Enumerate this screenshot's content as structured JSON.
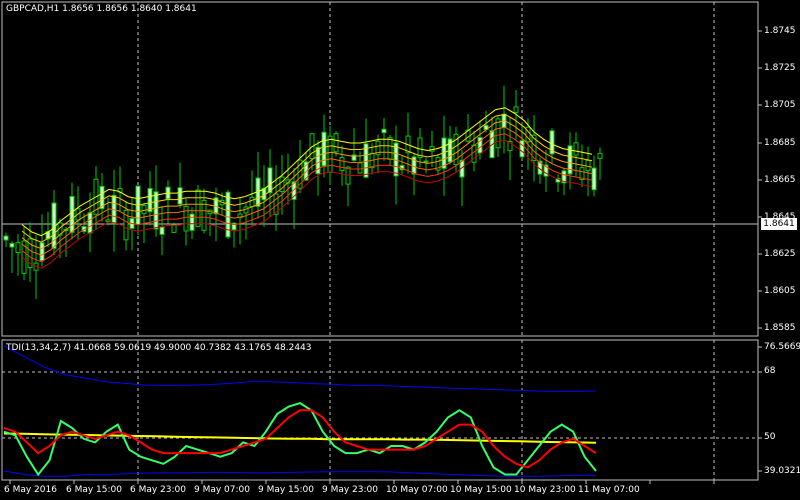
{
  "main_chart": {
    "title": "GBPCAD,H1  1.8656 1.8656 1.8640 1.8641",
    "current_price": "1.8641",
    "price_ticks": [
      "1.8745",
      "1.8725",
      "1.8705",
      "1.8685",
      "1.8665",
      "1.8645",
      "1.8625",
      "1.8605",
      "1.8585"
    ],
    "price_min": 1.8577,
    "price_max": 1.8755
  },
  "indicator": {
    "title": "TDI(13,34,2,7) 41.0668 59.0619 49.9000 40.7382 43.1765 48.2443",
    "ticks": [
      "76.5669",
      "68",
      "50",
      "39.0321"
    ],
    "level_top": 76.5669,
    "level_bottom": 39.0321
  },
  "time_axis": {
    "labels": [
      "6 May 2016",
      "6 May 15:00",
      "6 May 23:00",
      "9 May 07:00",
      "9 May 15:00",
      "9 May 23:00",
      "10 May 07:00",
      "10 May 15:00",
      "10 May 23:00",
      "11 May 07:00"
    ]
  },
  "colors": {
    "background": "#000000",
    "bull_candle": "#ccffcc",
    "wick": "#00cc00",
    "grid": "#c0c0c0",
    "tdi_green": "#33ff66",
    "tdi_red": "#ff0000",
    "tdi_yellow": "#ffff00",
    "tdi_band": "#0000ff"
  },
  "chart_data": {
    "type": "line",
    "ma_ribbon": [
      1.8628,
      1.8624,
      1.8622,
      1.8625,
      1.863,
      1.8634,
      1.8638,
      1.8641,
      1.8644,
      1.8647,
      1.8646,
      1.8643,
      1.8642,
      1.8643,
      1.8644,
      1.8645,
      1.8645,
      1.8646,
      1.8646,
      1.8646,
      1.8645,
      1.8643,
      1.8642,
      1.8643,
      1.8645,
      1.8647,
      1.8651,
      1.8655,
      1.866,
      1.8665,
      1.867,
      1.8673,
      1.8674,
      1.8673,
      1.8672,
      1.8672,
      1.8673,
      1.8674,
      1.8674,
      1.8673,
      1.8671,
      1.8669,
      1.8668,
      1.8669,
      1.8671,
      1.8674,
      1.8678,
      1.8682,
      1.8686,
      1.869,
      1.8691,
      1.8688,
      1.8684,
      1.8678,
      1.8674,
      1.8671,
      1.8669,
      1.8668,
      1.8667,
      1.8666
    ],
    "tdi_green": [
      52,
      51,
      45,
      40,
      44,
      55,
      53,
      50,
      49,
      52,
      54,
      47,
      45,
      44,
      43,
      45,
      48,
      47,
      46,
      45,
      46,
      49,
      48,
      52,
      57,
      59,
      60,
      58,
      52,
      48,
      46,
      46,
      47,
      46,
      48,
      48,
      47,
      49,
      52,
      56,
      58,
      56,
      48,
      42,
      40,
      40,
      44,
      48,
      52,
      54,
      52,
      45,
      41
    ],
    "tdi_red": [
      53,
      52,
      49,
      46,
      48,
      51,
      52,
      51,
      50,
      51,
      52,
      51,
      49,
      47,
      46,
      46,
      46,
      46,
      46,
      46,
      47,
      48,
      49,
      50,
      53,
      56,
      58,
      58,
      56,
      52,
      49,
      48,
      47,
      47,
      47,
      47,
      47,
      48,
      50,
      52,
      54,
      54,
      52,
      48,
      45,
      43,
      42,
      44,
      47,
      49,
      50,
      48,
      46
    ],
    "tdi_yellow": [
      51.5,
      51.4,
      51.3,
      51.2,
      51.1,
      51.0,
      50.9,
      50.8,
      50.7,
      50.6,
      50.5,
      50.4,
      50.3,
      50.2,
      50.1,
      50.0,
      50.0,
      49.9,
      49.9,
      49.9,
      49.9,
      49.8,
      49.8,
      49.7,
      49.6,
      49.5,
      49.4,
      49.3,
      49.2,
      49.1,
      49.0,
      48.9
    ],
    "tdi_upper_band": [
      76,
      73,
      70,
      68,
      67,
      66,
      65.5,
      65,
      65,
      65,
      65.2,
      65.5,
      66,
      66,
      65.8,
      65.5,
      65.3,
      65,
      65,
      64.8,
      64.6,
      64.4,
      64.2,
      64,
      63.8,
      63.6,
      63.4,
      63.3,
      63.3,
      63.4
    ],
    "tdi_lower_band": [
      41,
      40,
      39.5,
      39.5,
      40,
      40,
      40.2,
      40.4,
      40.5,
      40.5,
      40.6,
      40.6,
      40.5,
      40.5,
      40.6,
      40.7,
      40.8,
      40.8,
      40.8,
      40.7,
      40.5,
      40.2,
      40,
      39.8,
      39.6,
      39.5,
      39.5,
      39.6,
      39.8,
      39.8
    ]
  }
}
